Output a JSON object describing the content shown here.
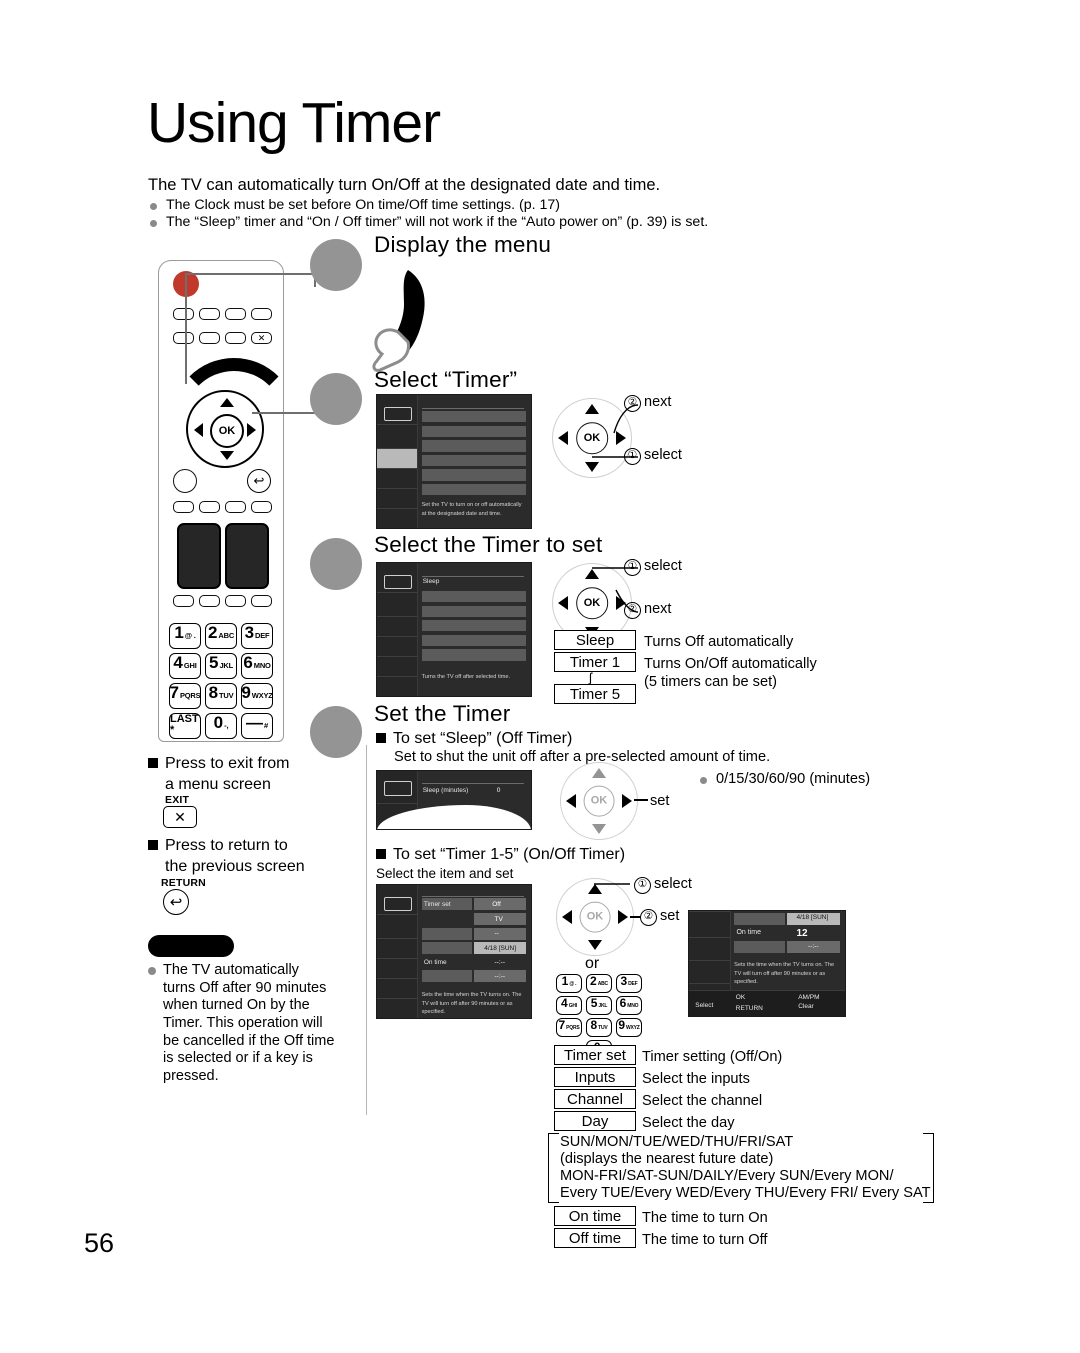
{
  "page": {
    "title": "Using Timer",
    "number": "56",
    "lead": "The TV can automatically turn On/Off at the designated date and time.",
    "bullets": [
      "The Clock must be set before On time/Off time settings. (p. 17)",
      "The “Sleep” timer and “On / Off timer” will not work if the “Auto power on” (p. 39) is set."
    ]
  },
  "steps": [
    {
      "heading": "Display the menu"
    },
    {
      "heading": "Select “Timer”"
    },
    {
      "heading": "Select the Timer to set"
    },
    {
      "heading": "Set the Timer"
    }
  ],
  "step2": {
    "menu_desc": "Set the TV to turn on or off automatically at the designated date and time.",
    "annotations": [
      {
        "num": "②",
        "label": "next"
      },
      {
        "num": "①",
        "label": "select"
      }
    ]
  },
  "step3": {
    "menu_first_item": "Sleep",
    "menu_desc": "Turns the TV off after selected time.",
    "annotations": [
      {
        "num": "①",
        "label": "select"
      },
      {
        "num": "②",
        "label": "next"
      }
    ],
    "legend": [
      {
        "box": "Sleep",
        "desc": "Turns Off automatically"
      },
      {
        "box": "Timer 1",
        "desc": "Turns On/Off automatically"
      },
      {
        "box": "Timer 5",
        "desc": "(5 timers can be set)"
      }
    ],
    "tilde": "ʃ"
  },
  "sleep": {
    "subhead": "To set “Sleep” (Off Timer)",
    "note": "Set to shut the unit off after a pre-selected amount of time.",
    "menu_label": "Sleep (minutes)",
    "menu_value": "0",
    "set_label": "set",
    "options": "0/15/30/60/90 (minutes)"
  },
  "timer15": {
    "subhead": "To set “Timer 1-5” (On/Off Timer)",
    "note": "Select the item and set",
    "annotations": [
      {
        "num": "①",
        "label": "select"
      },
      {
        "num": "②",
        "label": "set"
      }
    ],
    "or_label": "or",
    "menu_left": {
      "rows": [
        {
          "label": "Timer set",
          "value": "Off"
        },
        {
          "label": "",
          "value": "TV"
        },
        {
          "label": "",
          "value": "--"
        },
        {
          "label": "",
          "value": "4/18 [SUN]"
        },
        {
          "label": "On time",
          "value": "--:--"
        },
        {
          "label": "",
          "value": "--:--"
        }
      ],
      "desc": "Sets the time when the TV turns on. The TV will turn off after 90 minutes or as specified."
    },
    "menu_right": {
      "date_value": "4/18 [SUN]",
      "on_time_label": "On time",
      "on_time_value": "12",
      "off_value": "--:--",
      "desc": "Sets the time when the TV turns on. The TV will turn off after 90 minutes or as specified.",
      "footer": [
        {
          "label": "Select"
        },
        {
          "label": "OK"
        },
        {
          "label": "RETURN"
        },
        {
          "label": "AM/PM"
        },
        {
          "label": "Clear"
        }
      ]
    }
  },
  "legend_items": [
    {
      "box": "Timer set",
      "desc": "Timer setting (Off/On)"
    },
    {
      "box": "Inputs",
      "desc": "Select the inputs"
    },
    {
      "box": "Channel",
      "desc": "Select the channel"
    },
    {
      "box": "Day",
      "desc": "Select the day"
    }
  ],
  "day_block": [
    "SUN/MON/TUE/WED/THU/FRI/SAT",
    "(displays the nearest future date)",
    "MON-FRI/SAT-SUN/DAILY/Every SUN/Every MON/",
    "Every TUE/Every WED/Every THU/Every FRI/ Every SAT"
  ],
  "time_items": [
    {
      "box": "On time",
      "desc": "The time to turn On"
    },
    {
      "box": "Off time",
      "desc": "The time to turn Off"
    }
  ],
  "left_notes": [
    {
      "line1": "Press to exit from",
      "line2": "a menu screen",
      "cap": "EXIT",
      "glyph": "✕"
    },
    {
      "line1": "Press to return to",
      "line2": "the previous screen",
      "cap": "RETURN",
      "glyph": "↩"
    }
  ],
  "note": {
    "text": "The TV automatically turns Off after 90 minutes when turned On by the Timer. This operation will be cancelled if the Off time is selected or if a key is pressed."
  },
  "keypad": [
    {
      "d": "1",
      "s": "@ ."
    },
    {
      "d": "2",
      "s": "ABC"
    },
    {
      "d": "3",
      "s": "DEF"
    },
    {
      "d": "4",
      "s": "GHI"
    },
    {
      "d": "5",
      "s": "JKL"
    },
    {
      "d": "6",
      "s": "MNO"
    },
    {
      "d": "7",
      "s": "PQRS"
    },
    {
      "d": "8",
      "s": "TUV"
    },
    {
      "d": "9",
      "s": "WXYZ"
    },
    {
      "d": "LAST *",
      "s": ""
    },
    {
      "d": "0",
      "s": "-,"
    },
    {
      "d": "—",
      "s": "#"
    }
  ],
  "remote": {
    "ok_label": "OK",
    "exit_glyph": "✕",
    "return_glyph": "↩"
  },
  "colors": {
    "power": "#c0392b",
    "step_circle": "#949494",
    "menu_bg": "#2b2b2b",
    "highlight": "#b9b9b9"
  }
}
